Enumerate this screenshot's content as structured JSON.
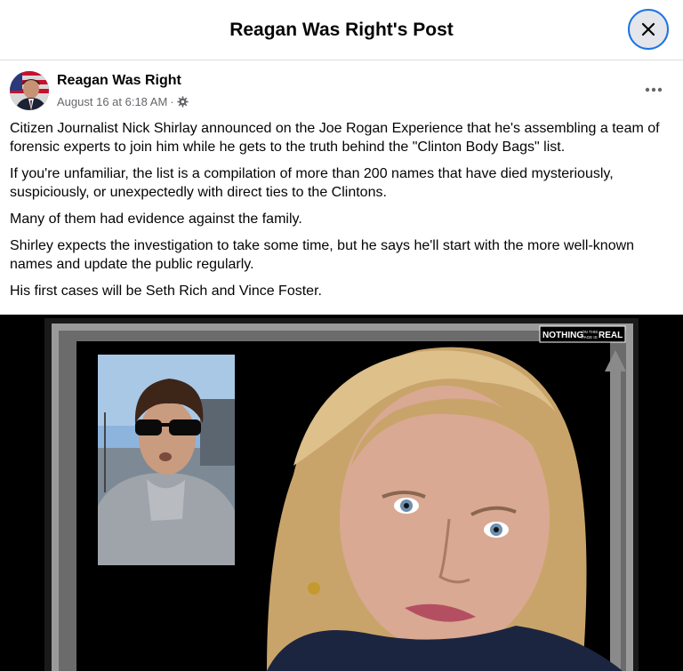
{
  "header": {
    "title": "Reagan Was Right's Post",
    "close_icon": "close-icon"
  },
  "post": {
    "author": "Reagan Was Right",
    "timestamp": "August 16 at 6:18 AM",
    "separator": "·",
    "audience_icon": "gear-icon",
    "more_icon": "more-options-icon",
    "paragraphs": [
      "Citizen Journalist Nick Shirlay announced on the Joe Rogan Experience that he's assembling a team of forensic experts to join him while he gets to the truth behind the \"Clinton Body Bags\" list.",
      "If you're unfamiliar, the list is a compilation of more than 200 names that have died mysteriously, suspiciously, or unexpectedly with direct ties to the Clintons.",
      "Many of them had evidence against the family.",
      "Shirley expects the investigation to take some time, but he says he'll start with the more well-known names and update the public regularly.",
      "His first cases will be Seth Rich and Vince Foster."
    ]
  },
  "image": {
    "watermark_left": "NOTHING",
    "watermark_small_1": "ON THIS",
    "watermark_small_2": "PAGE IS",
    "watermark_right": "REAL"
  }
}
